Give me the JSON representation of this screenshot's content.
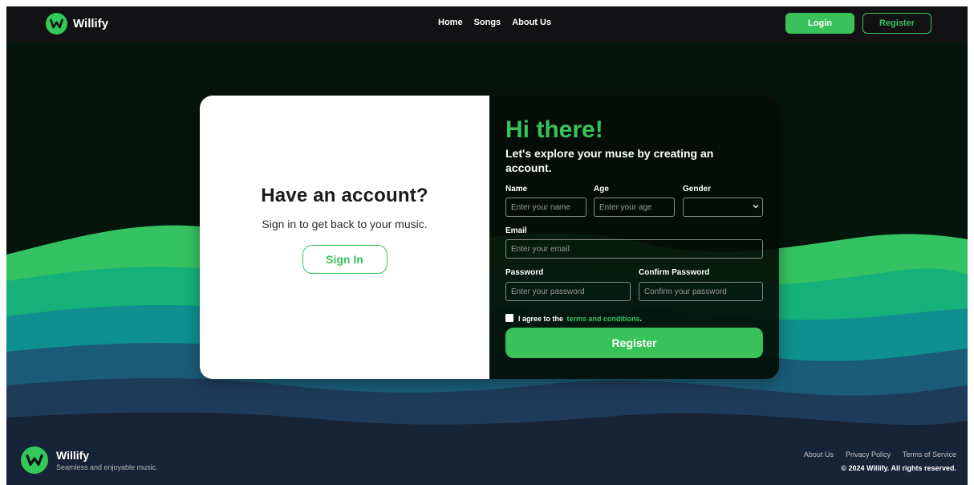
{
  "header": {
    "brand": "Willify",
    "nav": [
      "Home",
      "Songs",
      "About Us"
    ],
    "login_label": "Login",
    "register_label": "Register"
  },
  "signin_panel": {
    "title": "Have an account?",
    "subtitle": "Sign in to get back to your music.",
    "button_label": "Sign In"
  },
  "register_form": {
    "greeting": "Hi there!",
    "subtitle": "Let's explore your muse by creating an account.",
    "name": {
      "label": "Name",
      "placeholder": "Enter your name",
      "value": ""
    },
    "age": {
      "label": "Age",
      "placeholder": "Enter your age",
      "value": ""
    },
    "gender": {
      "label": "Gender",
      "value": ""
    },
    "email": {
      "label": "Email",
      "placeholder": "Enter your email",
      "value": ""
    },
    "password": {
      "label": "Password",
      "placeholder": "Enter your password",
      "value": ""
    },
    "confirm_password": {
      "label": "Confirm Password",
      "placeholder": "Confirm your password",
      "value": ""
    },
    "agree_prefix": "I agree to the",
    "agree_link": "terms and conditions",
    "agree_suffix": ".",
    "agree_checked": false,
    "submit_label": "Register"
  },
  "footer": {
    "brand": "Willify",
    "tagline": "Seamless and enjoyable music.",
    "links": [
      "About Us",
      "Privacy Policy",
      "Terms of Service"
    ],
    "copyright": "© 2024 Willify. All rights reserved."
  },
  "colors": {
    "accent": "#3ac25a",
    "header_bg": "#121214",
    "page_bg": "#06150b",
    "footer_bg": "#172437"
  },
  "icons": {
    "brand_logo": "willify-w-logo",
    "gender_dropdown": "chevron-down-icon"
  }
}
